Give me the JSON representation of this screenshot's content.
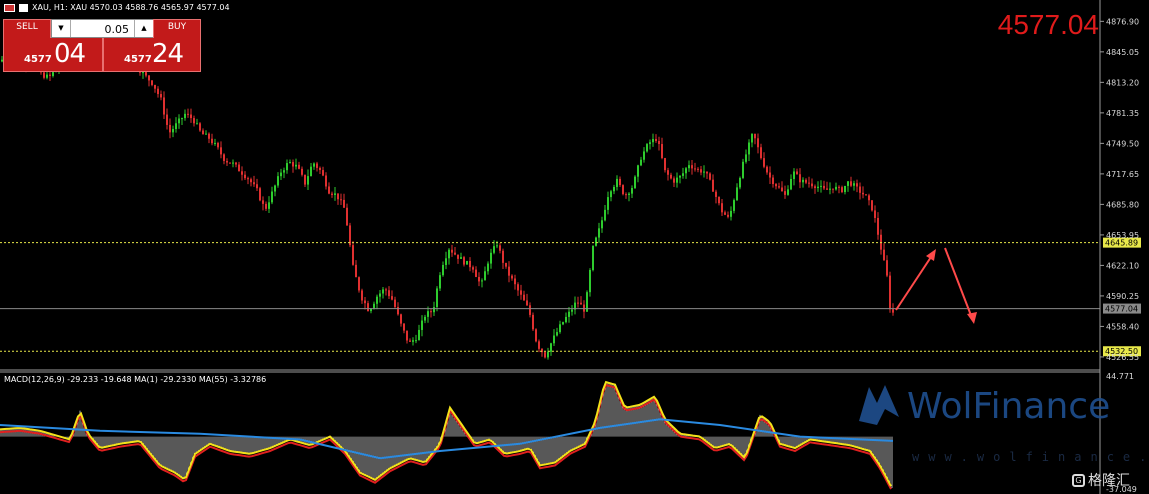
{
  "header": {
    "symbol_line": "XAU, H1:  XAU   4570.03 4588.76 4565.97 4577.04"
  },
  "trade_panel": {
    "sell_label": "SELL",
    "buy_label": "BUY",
    "lot_value": "0.05",
    "sell_price_small": "4577",
    "sell_price_big": "04",
    "buy_price_small": "4577",
    "buy_price_big": "24",
    "down_arrow": "▼",
    "up_arrow": "▲"
  },
  "current_price_big": "4577.04",
  "price_axis": {
    "ticks": [
      "4876.90",
      "4845.05",
      "4813.20",
      "4781.35",
      "4749.50",
      "4717.65",
      "4685.80",
      "4653.95",
      "4622.10",
      "4590.25",
      "4558.40",
      "4526.55"
    ],
    "levels": [
      {
        "label": "4645.89",
        "price": 4645.89,
        "style": "dotted",
        "color": "#e8e84a",
        "tag_bg": "#e8e84a",
        "tag_fg": "#000"
      },
      {
        "label": "4577.04",
        "price": 4577.04,
        "style": "solid",
        "color": "#8a8a8a",
        "tag_bg": "#8a8a8a",
        "tag_fg": "#000"
      },
      {
        "label": "4532.50",
        "price": 4532.5,
        "style": "dotted",
        "color": "#e8e84a",
        "tag_bg": "#e8e84a",
        "tag_fg": "#000"
      }
    ]
  },
  "macd": {
    "label": "MACD(12,26,9) -29.233 -19.648 MA(1) -29.2330 MA(55) -3.32786",
    "axis_top": "44.771",
    "axis_bottom": "-37.049"
  },
  "watermark": {
    "brand": "WolFinance",
    "url": "www.wolfinance.com",
    "source": "格隆汇"
  },
  "chart_data": {
    "type": "candlestick",
    "symbol": "XAU",
    "timeframe": "H1",
    "ohlc_last": {
      "open": 4570.03,
      "high": 4588.76,
      "low": 4565.97,
      "close": 4577.04
    },
    "ylim": [
      4515,
      4895
    ],
    "close_path": [
      [
        0,
        4835
      ],
      [
        8,
        4850
      ],
      [
        16,
        4840
      ],
      [
        24,
        4832
      ],
      [
        32,
        4838
      ],
      [
        40,
        4822
      ],
      [
        48,
        4818
      ],
      [
        56,
        4828
      ],
      [
        64,
        4832
      ],
      [
        72,
        4836
      ],
      [
        80,
        4845
      ],
      [
        88,
        4850
      ],
      [
        96,
        4830
      ],
      [
        104,
        4835
      ],
      [
        112,
        4840
      ],
      [
        120,
        4846
      ],
      [
        128,
        4852
      ],
      [
        136,
        4830
      ],
      [
        144,
        4820
      ],
      [
        152,
        4812
      ],
      [
        160,
        4795
      ],
      [
        168,
        4760
      ],
      [
        176,
        4770
      ],
      [
        184,
        4780
      ],
      [
        192,
        4775
      ],
      [
        200,
        4760
      ],
      [
        208,
        4755
      ],
      [
        216,
        4745
      ],
      [
        224,
        4732
      ],
      [
        232,
        4728
      ],
      [
        240,
        4720
      ],
      [
        248,
        4712
      ],
      [
        256,
        4700
      ],
      [
        264,
        4680
      ],
      [
        272,
        4700
      ],
      [
        280,
        4720
      ],
      [
        288,
        4730
      ],
      [
        296,
        4725
      ],
      [
        304,
        4708
      ],
      [
        312,
        4730
      ],
      [
        320,
        4720
      ],
      [
        328,
        4700
      ],
      [
        336,
        4695
      ],
      [
        344,
        4680
      ],
      [
        352,
        4620
      ],
      [
        360,
        4590
      ],
      [
        368,
        4575
      ],
      [
        376,
        4590
      ],
      [
        384,
        4598
      ],
      [
        392,
        4585
      ],
      [
        400,
        4560
      ],
      [
        408,
        4540
      ],
      [
        416,
        4548
      ],
      [
        424,
        4570
      ],
      [
        432,
        4575
      ],
      [
        440,
        4620
      ],
      [
        448,
        4640
      ],
      [
        456,
        4632
      ],
      [
        464,
        4625
      ],
      [
        472,
        4620
      ],
      [
        480,
        4600
      ],
      [
        488,
        4630
      ],
      [
        496,
        4645
      ],
      [
        504,
        4620
      ],
      [
        512,
        4605
      ],
      [
        520,
        4590
      ],
      [
        528,
        4575
      ],
      [
        536,
        4540
      ],
      [
        544,
        4528
      ],
      [
        552,
        4545
      ],
      [
        560,
        4560
      ],
      [
        568,
        4572
      ],
      [
        576,
        4585
      ],
      [
        584,
        4575
      ],
      [
        592,
        4640
      ],
      [
        600,
        4665
      ],
      [
        608,
        4700
      ],
      [
        616,
        4710
      ],
      [
        624,
        4695
      ],
      [
        632,
        4705
      ],
      [
        640,
        4735
      ],
      [
        648,
        4750
      ],
      [
        656,
        4755
      ],
      [
        664,
        4720
      ],
      [
        672,
        4710
      ],
      [
        680,
        4715
      ],
      [
        688,
        4728
      ],
      [
        696,
        4722
      ],
      [
        704,
        4720
      ],
      [
        712,
        4702
      ],
      [
        720,
        4680
      ],
      [
        728,
        4670
      ],
      [
        736,
        4705
      ],
      [
        744,
        4735
      ],
      [
        752,
        4760
      ],
      [
        760,
        4735
      ],
      [
        768,
        4715
      ],
      [
        776,
        4705
      ],
      [
        784,
        4695
      ],
      [
        792,
        4720
      ],
      [
        800,
        4710
      ],
      [
        808,
        4708
      ],
      [
        816,
        4705
      ],
      [
        824,
        4700
      ],
      [
        832,
        4704
      ],
      [
        840,
        4700
      ],
      [
        848,
        4710
      ],
      [
        856,
        4702
      ],
      [
        864,
        4695
      ],
      [
        872,
        4680
      ],
      [
        880,
        4640
      ],
      [
        886,
        4610
      ],
      [
        890,
        4568
      ],
      [
        894,
        4577
      ]
    ],
    "macd_path": [
      [
        0,
        5
      ],
      [
        20,
        6
      ],
      [
        40,
        4
      ],
      [
        60,
        0
      ],
      [
        70,
        -2
      ],
      [
        80,
        18
      ],
      [
        88,
        2
      ],
      [
        100,
        -8
      ],
      [
        120,
        -5
      ],
      [
        140,
        -3
      ],
      [
        160,
        -20
      ],
      [
        175,
        -25
      ],
      [
        185,
        -30
      ],
      [
        195,
        -12
      ],
      [
        210,
        -5
      ],
      [
        230,
        -10
      ],
      [
        250,
        -12
      ],
      [
        270,
        -8
      ],
      [
        290,
        -2
      ],
      [
        310,
        -6
      ],
      [
        330,
        0
      ],
      [
        345,
        -10
      ],
      [
        360,
        -25
      ],
      [
        375,
        -30
      ],
      [
        390,
        -22
      ],
      [
        410,
        -15
      ],
      [
        425,
        -18
      ],
      [
        440,
        -5
      ],
      [
        450,
        20
      ],
      [
        460,
        10
      ],
      [
        475,
        -5
      ],
      [
        490,
        -2
      ],
      [
        505,
        -12
      ],
      [
        520,
        -10
      ],
      [
        530,
        -8
      ],
      [
        540,
        -20
      ],
      [
        555,
        -18
      ],
      [
        570,
        -10
      ],
      [
        585,
        -5
      ],
      [
        595,
        10
      ],
      [
        605,
        38
      ],
      [
        615,
        36
      ],
      [
        625,
        20
      ],
      [
        640,
        22
      ],
      [
        655,
        28
      ],
      [
        665,
        12
      ],
      [
        680,
        2
      ],
      [
        700,
        0
      ],
      [
        715,
        -8
      ],
      [
        730,
        -5
      ],
      [
        745,
        -15
      ],
      [
        760,
        15
      ],
      [
        770,
        10
      ],
      [
        780,
        -5
      ],
      [
        795,
        -8
      ],
      [
        810,
        -2
      ],
      [
        830,
        -4
      ],
      [
        850,
        -6
      ],
      [
        870,
        -10
      ],
      [
        880,
        -20
      ],
      [
        893,
        -37
      ]
    ],
    "macd_ma_path": [
      [
        0,
        8
      ],
      [
        100,
        4
      ],
      [
        200,
        2
      ],
      [
        300,
        -2
      ],
      [
        380,
        -15
      ],
      [
        440,
        -10
      ],
      [
        520,
        -5
      ],
      [
        600,
        6
      ],
      [
        660,
        12
      ],
      [
        720,
        8
      ],
      [
        800,
        0
      ],
      [
        893,
        -3
      ]
    ],
    "macd_ylim": [
      -37.049,
      44.771
    ]
  }
}
